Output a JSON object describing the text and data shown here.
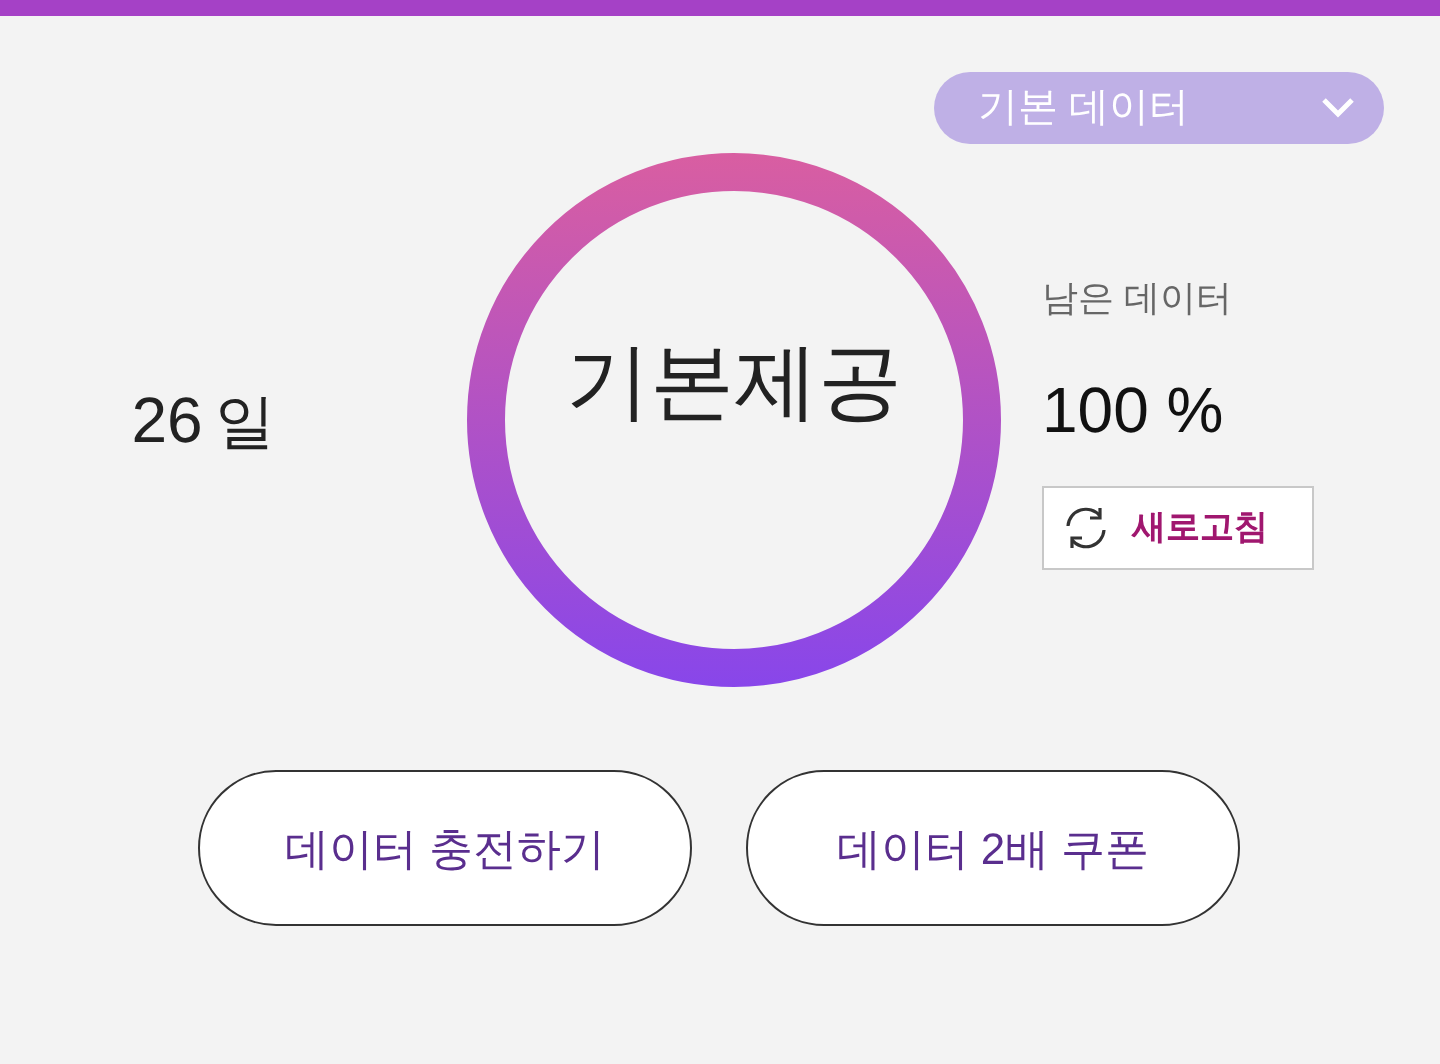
{
  "plan_dropdown": {
    "value": "기본 데이터"
  },
  "days": {
    "number": "26",
    "unit": "일"
  },
  "ring": {
    "label": "기본제공"
  },
  "remaining": {
    "label": "남은 데이터",
    "value": "100 %"
  },
  "refresh_button": {
    "label": "새로고침"
  },
  "buttons": [
    {
      "label": "데이터 충전하기"
    },
    {
      "label": "데이터 2배 쿠폰"
    }
  ]
}
